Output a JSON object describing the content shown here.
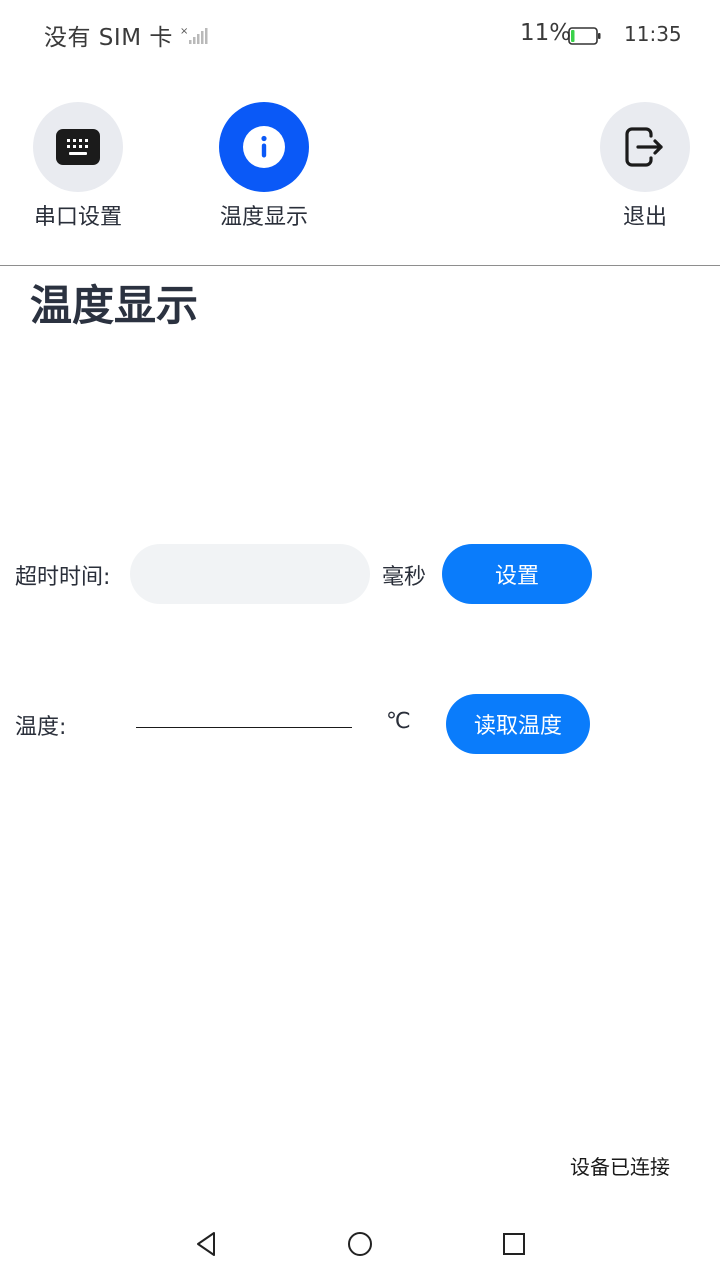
{
  "status_bar": {
    "sim": "没有 SIM 卡",
    "battery": "11%",
    "time": "11:35",
    "signal_icon": "signal-icon",
    "battery_icon": "battery-icon"
  },
  "nav": {
    "items": [
      {
        "label": "串口设置",
        "icon": "keyboard-icon",
        "active": false
      },
      {
        "label": "温度显示",
        "icon": "info-icon",
        "active": true
      },
      {
        "label": "退出",
        "icon": "exit-icon",
        "active": false
      }
    ]
  },
  "page": {
    "title": "温度显示"
  },
  "timeout": {
    "label": "超时时间:",
    "value": "",
    "unit": "毫秒",
    "button": "设置"
  },
  "temperature": {
    "label": "温度:",
    "value": "",
    "unit": "℃",
    "button": "读取温度"
  },
  "status": {
    "connection": "设备已连接"
  },
  "colors": {
    "active_nav": "#0a59f7",
    "button": "#0a7cfb",
    "inactive_nav": "#e9ebf0"
  },
  "system_nav": {
    "back_icon": "back-triangle-icon",
    "home_icon": "home-circle-icon",
    "recent_icon": "recent-square-icon"
  }
}
